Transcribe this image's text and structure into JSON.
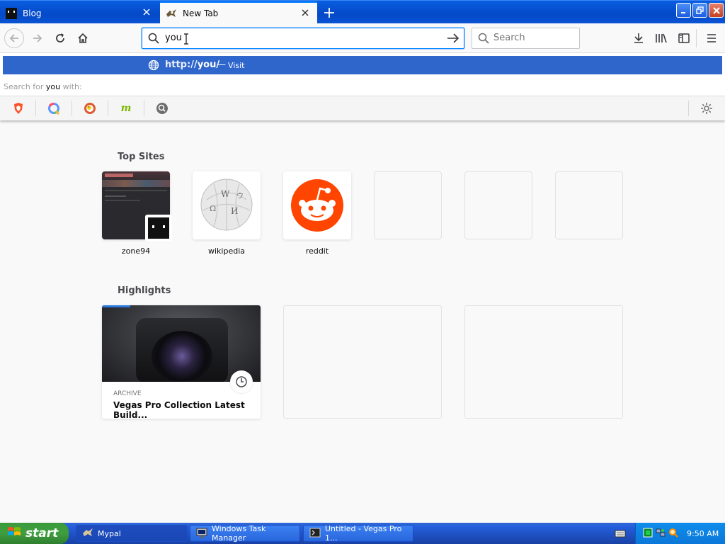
{
  "tabs": [
    {
      "title": "Blog"
    },
    {
      "title": "New Tab"
    }
  ],
  "urlbar": {
    "value": "you"
  },
  "searchbar": {
    "placeholder": "Search"
  },
  "suggestion": {
    "url_prefix": "http://",
    "url_bold": "you/",
    "separator": "—",
    "action": "Visit"
  },
  "search_for": {
    "prefix": "Search for ",
    "term": "you",
    "suffix": " with:"
  },
  "search_engines": [
    "brave-icon",
    "qwant-icon",
    "duckduckgo-icon",
    "mojeek-icon",
    "search-engine-icon"
  ],
  "top_sites": {
    "title": "Top Sites",
    "items": [
      {
        "label": "zone94"
      },
      {
        "label": "wikipedia"
      },
      {
        "label": "reddit"
      }
    ]
  },
  "highlights": {
    "title": "Highlights",
    "items": [
      {
        "category": "ARCHIVE",
        "title": "Vegas Pro Collection Latest Build..."
      }
    ]
  },
  "taskbar": {
    "start": "start",
    "tasks": [
      {
        "label": "Mypal"
      },
      {
        "label": "Windows Task Manager"
      },
      {
        "label": "Untitled - Vegas Pro 1..."
      }
    ],
    "clock": "9:50 AM"
  },
  "colors": {
    "accent": "#0a84ff",
    "suggestion_bg": "#2f66cc",
    "reddit": "#ff4500",
    "xp_blue": "#245edb",
    "xp_green": "#3e9e3e"
  }
}
